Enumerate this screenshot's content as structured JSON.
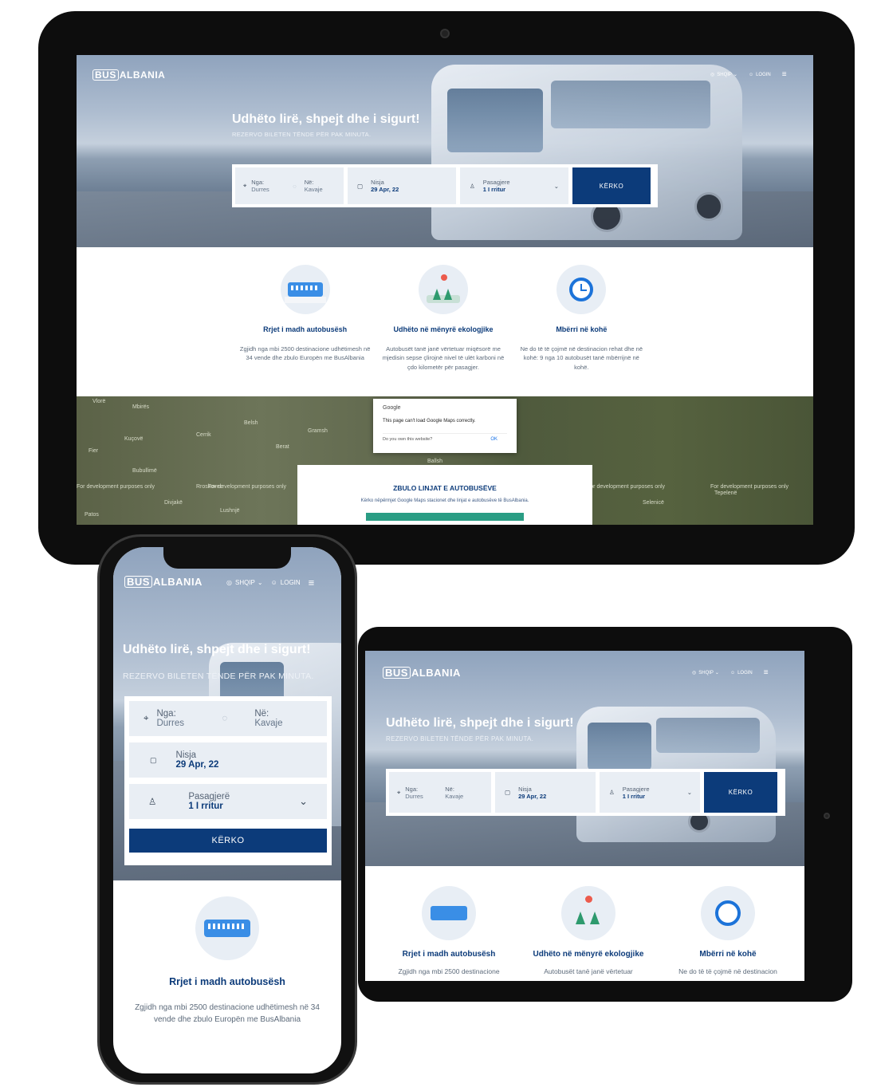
{
  "logo": {
    "box": "BUS",
    "text": "ALBANIA"
  },
  "nav": {
    "language": "SHQIP",
    "login": "LOGIN"
  },
  "hero": {
    "title": "Udhëto lirë, shpejt dhe i sigurt!",
    "subtitle": "REZERVO BILETEN TËNDE PËR PAK MINUTA."
  },
  "search": {
    "from_label": "Nga:",
    "from_value": "Durres",
    "to_label": "Në:",
    "to_value": "Kavaje",
    "date_label": "Nisja",
    "date_value": "29 Apr, 22",
    "pass_label_desktop": "Pasagjere",
    "pass_label_mobile": "Pasagjerë",
    "pass_value": "1 I rritur",
    "button": "KËRKO"
  },
  "features": [
    {
      "title": "Rrjet i madh autobusësh",
      "text": "Zgjidh nga mbi 2500 destinacione udhëtimesh në 34 vende dhe zbulo Europën me BusAlbania",
      "icon": "bus-icon"
    },
    {
      "title": "Udhëto në mënyrë ekologjike",
      "text": "Autobusët tanë janë vërtetuar miqësorë me mjedisin sepse çlirojnë nivel të ulët karboni në çdo kilometër për pasagjer.",
      "icon": "eco-trees-icon"
    },
    {
      "title": "Mbërri në kohë",
      "text": "Ne do të të çojmë në destinacion rehat dhe në kohë: 9 nga 10 autobusët tanë mbërrijnë në kohë.",
      "icon": "clock-icon"
    }
  ],
  "tablet_features": [
    {
      "title": "Rrjet i madh autobusësh",
      "text": "Zgjidh nga mbi 2500 destinacione"
    },
    {
      "title": "Udhëto në mënyrë ekologjike",
      "text": "Autobusët tanë janë vërtetuar"
    },
    {
      "title": "Mbërri në kohë",
      "text": "Ne do të të çojmë në destinacion"
    }
  ],
  "phone_feature": {
    "title": "Rrjet i madh autobusësh",
    "text": "Zgjidh nga mbi 2500 destinacione udhëtimesh në 34 vende dhe zbulo Europën me BusAlbania"
  },
  "map": {
    "dialog_title": "Google",
    "dialog_message": "This page can't load Google Maps correctly.",
    "dialog_question": "Do you own this website?",
    "dialog_ok": "OK",
    "watermark": "For development purposes only",
    "places": [
      "Vlorë",
      "Mbirës",
      "Cerrik",
      "Belsh",
      "Gramsh",
      "Kuçovë",
      "Berat",
      "Fier",
      "Bubullimë",
      "Rroskovec",
      "Divjakë",
      "Lushnjë",
      "Patos",
      "Ballsh",
      "Selenicë",
      "Tepelenë"
    ]
  },
  "explore": {
    "title": "ZBULO LINJAT E AUTOBUSËVE",
    "text": "Kërko nëpërmjet Google Maps stacionet dhe linjat e autobusëve të BusAlbania."
  },
  "colors": {
    "brand_blue": "#0c3b7a",
    "field_bg": "#e9eef4",
    "accent_green": "#2a9d84"
  }
}
